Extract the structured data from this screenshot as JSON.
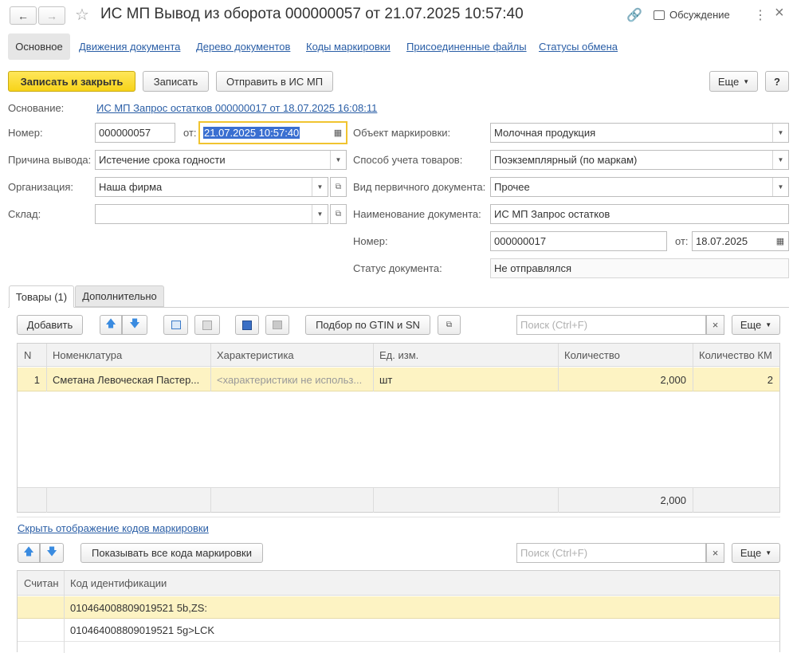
{
  "window": {
    "title": "ИС МП Вывод из оборота 000000057 от 21.07.2025 10:57:40",
    "discussion_label": "Обсуждение",
    "more_glyph": "⋮",
    "close_glyph": "×"
  },
  "section_tabs": [
    {
      "label": "Основное",
      "active": true
    },
    {
      "label": "Движения документа"
    },
    {
      "label": "Дерево документов"
    },
    {
      "label": "Коды маркировки"
    },
    {
      "label": "Присоединенные файлы"
    },
    {
      "label": "Статусы обмена"
    }
  ],
  "toolbar": {
    "save_close": "Записать и закрыть",
    "save": "Записать",
    "send": "Отправить в ИС МП",
    "more": "Еще",
    "help": "?"
  },
  "form": {
    "basis_label": "Основание:",
    "basis_value": "ИС МП Запрос остатков 000000017 от 18.07.2025 16:08:11",
    "number_label": "Номер:",
    "number_value": "000000057",
    "date_label": "от:",
    "date_value": "21.07.2025 10:57:40",
    "reason_label": "Причина вывода:",
    "reason_value": "Истечение срока годности",
    "org_label": "Организация:",
    "org_value": "Наша фирма",
    "warehouse_label": "Склад:",
    "warehouse_value": "",
    "object_label": "Объект маркировки:",
    "object_value": "Молочная продукция",
    "accounting_label": "Способ учета товаров:",
    "accounting_value": "Поэкземплярный (по маркам)",
    "primary_doc_label": "Вид первичного документа:",
    "primary_doc_value": "Прочее",
    "doc_name_label": "Наименование документа:",
    "doc_name_value": "ИС МП Запрос остатков",
    "doc_number_label": "Номер:",
    "doc_number_value": "000000017",
    "doc_date_label": "от:",
    "doc_date_value": "18.07.2025",
    "status_label": "Статус документа:",
    "status_value": "Не отправлялся"
  },
  "inner_tabs": [
    {
      "label": "Товары (1)",
      "active": true
    },
    {
      "label": "Дополнительно"
    }
  ],
  "goods_toolbar": {
    "add": "Добавить",
    "pick": "Подбор по GTIN и SN",
    "search_placeholder": "Поиск (Ctrl+F)",
    "more": "Еще"
  },
  "goods_table": {
    "columns": [
      "N",
      "Номенклатура",
      "Характеристика",
      "Ед. изм.",
      "Количество",
      "Количество КМ"
    ],
    "rows": [
      {
        "n": "1",
        "name": "Сметана Левоческая Пастер...",
        "characteristic": "<характеристики не использ...",
        "unit": "шт",
        "qty": "2,000",
        "km": "2"
      }
    ],
    "footer_qty": "2,000"
  },
  "codes": {
    "toggle_link": "Скрыть отображение кодов маркировки",
    "show_all": "Показывать все кода маркировки",
    "search_placeholder": "Поиск (Ctrl+F)",
    "more": "Еще",
    "columns": [
      "Считан",
      "Код идентификации"
    ],
    "rows": [
      {
        "read": "",
        "code": "010464008809019521 5b,ZS:"
      },
      {
        "read": "",
        "code": "010464008809019521 5g>LCK"
      }
    ]
  },
  "colors": {
    "accent": "#f7d319",
    "selected_row": "#fdf3c3",
    "link": "#2a5ea6"
  }
}
